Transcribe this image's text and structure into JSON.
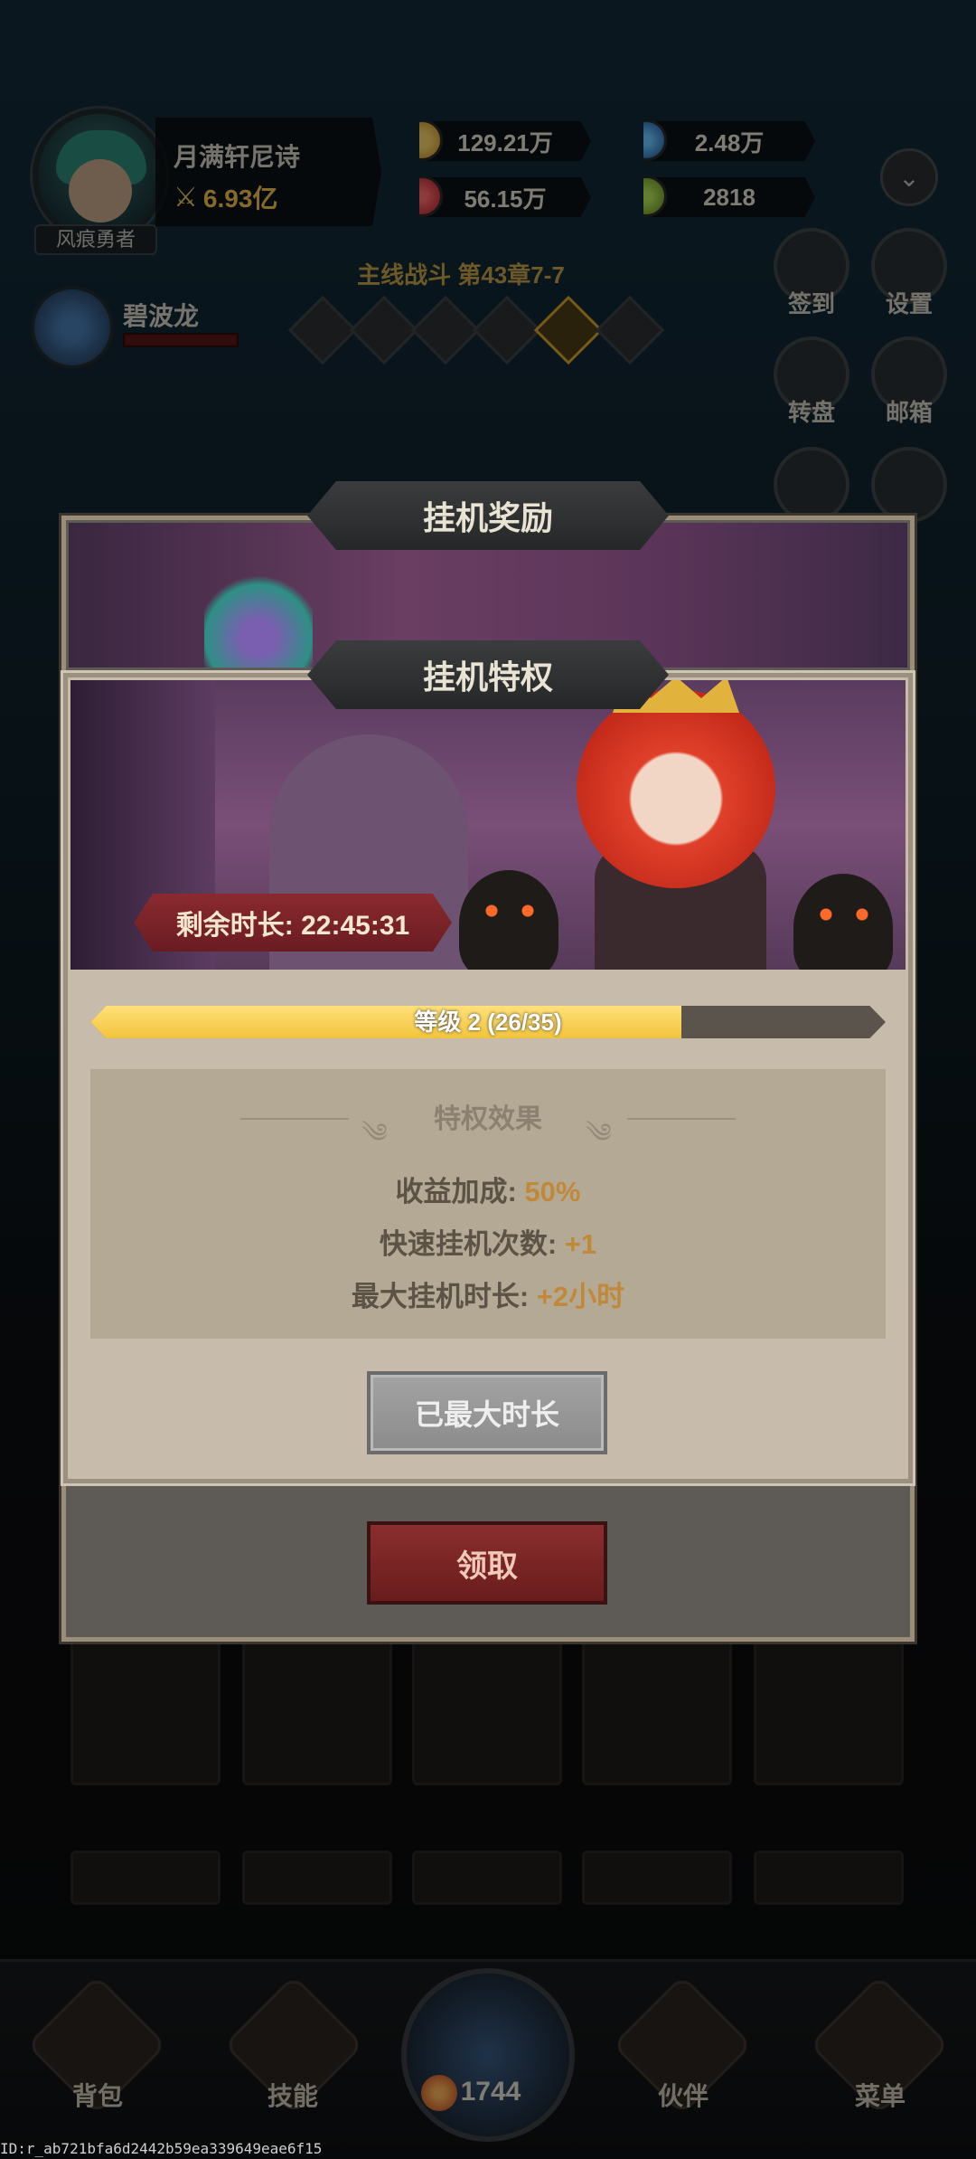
{
  "header": {
    "player_name": "月满轩尼诗",
    "power": "6.93亿",
    "rank_title": "风痕勇者",
    "pet_name": "碧波龙",
    "resources": {
      "gold": "129.21万",
      "diamond": "2.48万",
      "ruby": "56.15万",
      "ticket": "2818"
    },
    "stage_title": "主线战斗 第43章7-7"
  },
  "side_menu": {
    "checkin": "签到",
    "settings": "设置",
    "wheel": "转盘",
    "mail": "邮箱"
  },
  "back_modal": {
    "title": "挂机奖励",
    "claim_button": "领取"
  },
  "modal": {
    "title": "挂机特权",
    "timer": "剩余时长: 22:45:31",
    "level_text": "等级 2 (26/35)",
    "level_progress": 0.743,
    "effects_header": "特权效果",
    "effects": [
      {
        "label": "收益加成: ",
        "value": "50%"
      },
      {
        "label": "快速挂机次数: ",
        "value": "+1"
      },
      {
        "label": "最大挂机时长: ",
        "value": "+2小时"
      }
    ],
    "max_button": "已最大时长"
  },
  "bottom_nav": {
    "bag": "背包",
    "skills": "技能",
    "battle_count": "1744",
    "partner": "伙伴",
    "menu": "菜单"
  },
  "watermark": "ID:r_ab721bfa6d2442b59ea339649eae6f15"
}
